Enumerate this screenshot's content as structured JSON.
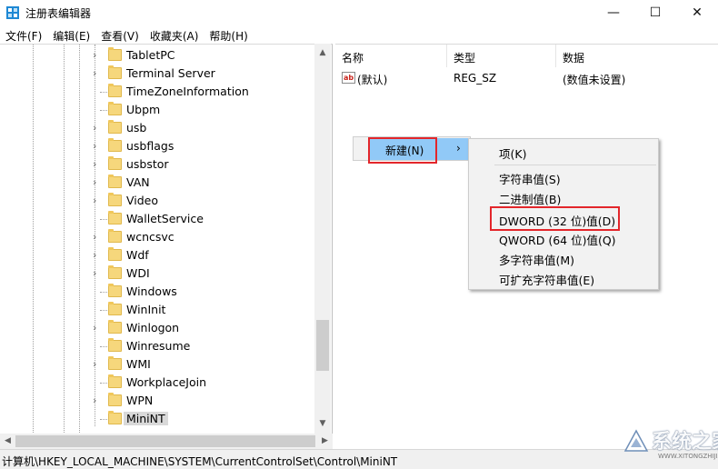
{
  "window": {
    "title": "注册表编辑器",
    "minimize_glyph": "—",
    "maximize_glyph": "☐",
    "close_glyph": "✕",
    "app_icon": "regedit-icon"
  },
  "menu": [
    "文件(F)",
    "编辑(E)",
    "查看(V)",
    "收藏夹(A)",
    "帮助(H)"
  ],
  "tree": {
    "items": [
      {
        "label": "TabletPC",
        "expandable": true
      },
      {
        "label": "Terminal Server",
        "expandable": true
      },
      {
        "label": "TimeZoneInformation",
        "expandable": false
      },
      {
        "label": "Ubpm",
        "expandable": false
      },
      {
        "label": "usb",
        "expandable": true
      },
      {
        "label": "usbflags",
        "expandable": true
      },
      {
        "label": "usbstor",
        "expandable": true
      },
      {
        "label": "VAN",
        "expandable": true
      },
      {
        "label": "Video",
        "expandable": true
      },
      {
        "label": "WalletService",
        "expandable": false
      },
      {
        "label": "wcncsvc",
        "expandable": true
      },
      {
        "label": "Wdf",
        "expandable": true
      },
      {
        "label": "WDI",
        "expandable": true
      },
      {
        "label": "Windows",
        "expandable": false
      },
      {
        "label": "WinInit",
        "expandable": false
      },
      {
        "label": "Winlogon",
        "expandable": true
      },
      {
        "label": "Winresume",
        "expandable": false
      },
      {
        "label": "WMI",
        "expandable": true
      },
      {
        "label": "WorkplaceJoin",
        "expandable": false
      },
      {
        "label": "WPN",
        "expandable": true
      },
      {
        "label": "MiniNT",
        "expandable": false,
        "selected": true
      }
    ]
  },
  "columns": {
    "name": "名称",
    "type": "类型",
    "data": "数据"
  },
  "values": [
    {
      "name": "(默认)",
      "type": "REG_SZ",
      "data": "(数值未设置)"
    }
  ],
  "context_menu": {
    "new_label": "新建(N)",
    "submenu_arrow": "›",
    "submenu": [
      "项(K)",
      "字符串值(S)",
      "二进制值(B)",
      "DWORD (32 位)值(D)",
      "QWORD (64 位)值(Q)",
      "多字符串值(M)",
      "可扩充字符串值(E)"
    ]
  },
  "status": {
    "path": "计算机\\HKEY_LOCAL_MACHINE\\SYSTEM\\CurrentControlSet\\Control\\MiniNT"
  },
  "watermark": {
    "text": "系统之家",
    "url": "WWW.XITONGZHIJIA.NET"
  },
  "colors": {
    "highlight": "#91c9f7",
    "annotation_red": "#e3262b",
    "folder": "#f6d77c"
  }
}
